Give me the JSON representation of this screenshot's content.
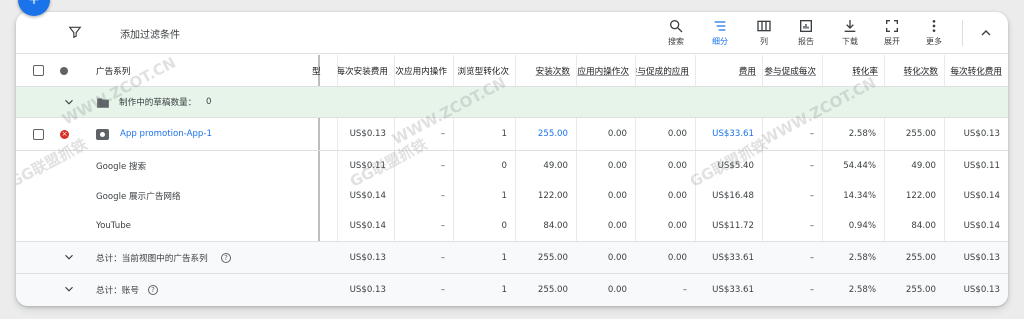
{
  "toolbar": {
    "add_filter": "添加过滤条件",
    "tools": [
      {
        "label": "搜索",
        "icon": "search-icon"
      },
      {
        "label": "细分",
        "icon": "segment-icon"
      },
      {
        "label": "列",
        "icon": "columns-icon"
      },
      {
        "label": "报告",
        "icon": "reports-icon"
      },
      {
        "label": "下载",
        "icon": "download-icon"
      },
      {
        "label": "展开",
        "icon": "expand-icon"
      },
      {
        "label": "更多",
        "icon": "more-icon"
      }
    ]
  },
  "table": {
    "campaign_header": "广告系列",
    "col0_stub": "型",
    "columns": [
      "每次安装费用",
      "每次应用内操作",
      "浏览型转化次",
      "安装次数",
      "应用内操作次",
      "参与促成的应用",
      "费用",
      "参与促成每次",
      "转化率",
      "转化次数",
      "每次转化费用"
    ],
    "draft_label": "制作中的草稿数量：",
    "draft_count": "0",
    "campaign": {
      "name": "App promotion-App-1",
      "values": [
        "US$0.13",
        "–",
        "1",
        "255.00",
        "0.00",
        "0.00",
        "US$33.61",
        "–",
        "2.58%",
        "255.00",
        "US$0.13"
      ]
    },
    "segments": [
      {
        "name": "Google 搜索",
        "values": [
          "US$0.11",
          "–",
          "0",
          "49.00",
          "0.00",
          "0.00",
          "US$5.40",
          "–",
          "54.44%",
          "49.00",
          "US$0.11"
        ]
      },
      {
        "name": "Google 展示广告网络",
        "values": [
          "US$0.14",
          "–",
          "1",
          "122.00",
          "0.00",
          "0.00",
          "US$16.48",
          "–",
          "14.34%",
          "122.00",
          "US$0.14"
        ]
      },
      {
        "name": "YouTube",
        "values": [
          "US$0.14",
          "–",
          "0",
          "84.00",
          "0.00",
          "0.00",
          "US$11.72",
          "–",
          "0.94%",
          "84.00",
          "US$0.14"
        ]
      }
    ],
    "totals": [
      {
        "label": "总计：当前视图中的广告系列",
        "values": [
          "US$0.13",
          "–",
          "1",
          "255.00",
          "0.00",
          "0.00",
          "US$33.61",
          "–",
          "2.58%",
          "255.00",
          "US$0.13"
        ]
      },
      {
        "label": "总计：账号",
        "values": [
          "US$0.13",
          "–",
          "1",
          "255.00",
          "0.00",
          "–",
          "US$33.61",
          "–",
          "2.58%",
          "255.00",
          "US$0.13"
        ]
      }
    ]
  },
  "watermark": {
    "cn": "GG联盟抓铁",
    "en": "WWW.ZCOT.CN"
  }
}
